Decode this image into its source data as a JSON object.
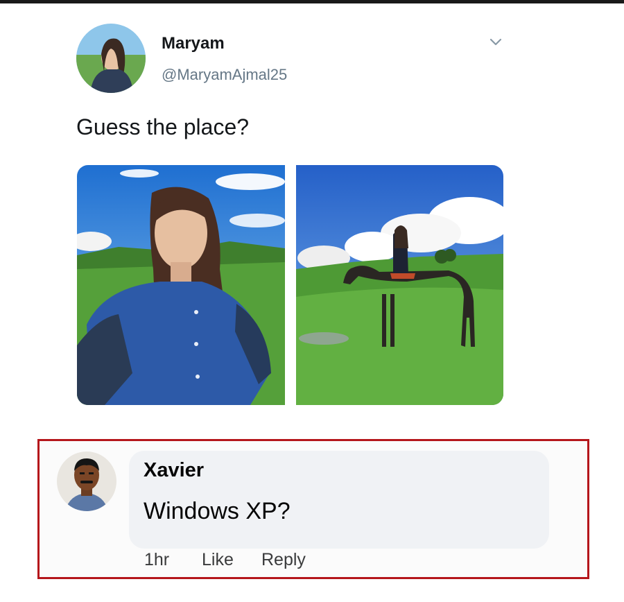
{
  "tweet": {
    "author_name": "Maryam",
    "author_handle": "@MaryamAjmal25",
    "text": "Guess the place?",
    "menu_icon": "chevron-down-icon"
  },
  "photos": [
    {
      "subject": "selfie in green meadow under blue sky"
    },
    {
      "subject": "rider on dark horse in green meadow"
    }
  ],
  "comment": {
    "author_name": "Xavier",
    "text": "Windows XP?",
    "time": "1hr",
    "like_label": "Like",
    "reply_label": "Reply",
    "highlight_color": "#b5161b"
  }
}
